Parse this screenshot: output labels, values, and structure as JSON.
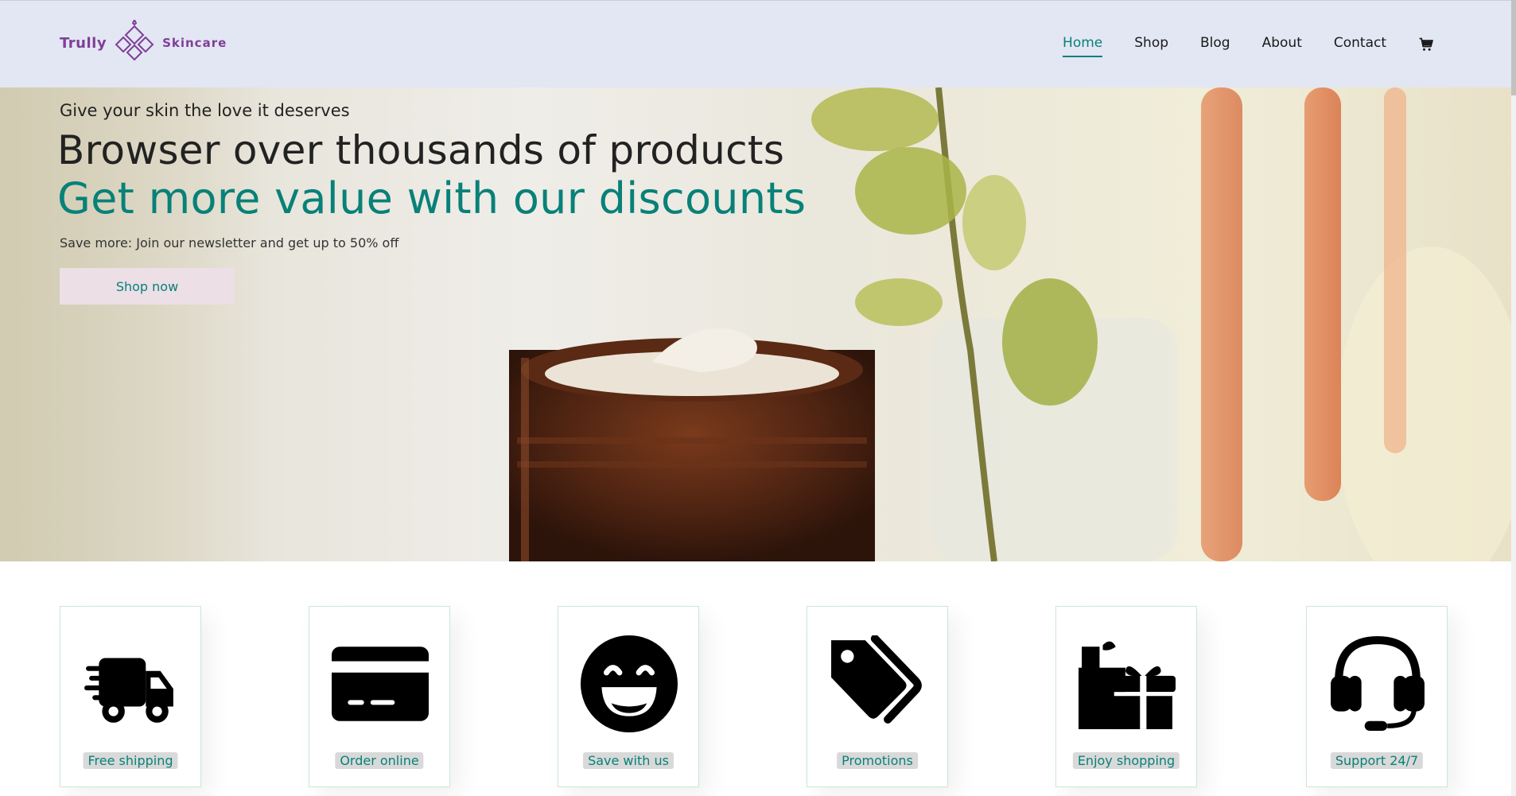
{
  "brand": {
    "name_left": "Trully",
    "name_right": "Skincare",
    "color": "#7e3f97"
  },
  "nav": {
    "items": [
      "Home",
      "Shop",
      "Blog",
      "About",
      "Contact"
    ],
    "active": "Home",
    "cart_icon": "cart-icon"
  },
  "hero": {
    "eyebrow": "Give your skin the love it deserves",
    "headline": "Browser over thousands of products",
    "highlight": "Get more value with our discounts",
    "subtext": "Save more: Join our newsletter and get up to 50% off",
    "button": "Shop now"
  },
  "features": [
    {
      "label": "Free shipping",
      "icon": "truck-icon"
    },
    {
      "label": "Order online",
      "icon": "credit-card-icon"
    },
    {
      "label": "Save with us",
      "icon": "smile-icon"
    },
    {
      "label": "Promotions",
      "icon": "tags-icon"
    },
    {
      "label": "Enjoy shopping",
      "icon": "gifts-icon"
    },
    {
      "label": "Support 24/7",
      "icon": "headset-icon"
    }
  ],
  "colors": {
    "accent": "#088178",
    "header_bg": "#e3e6f3",
    "button_bg": "#ecdfe6"
  }
}
